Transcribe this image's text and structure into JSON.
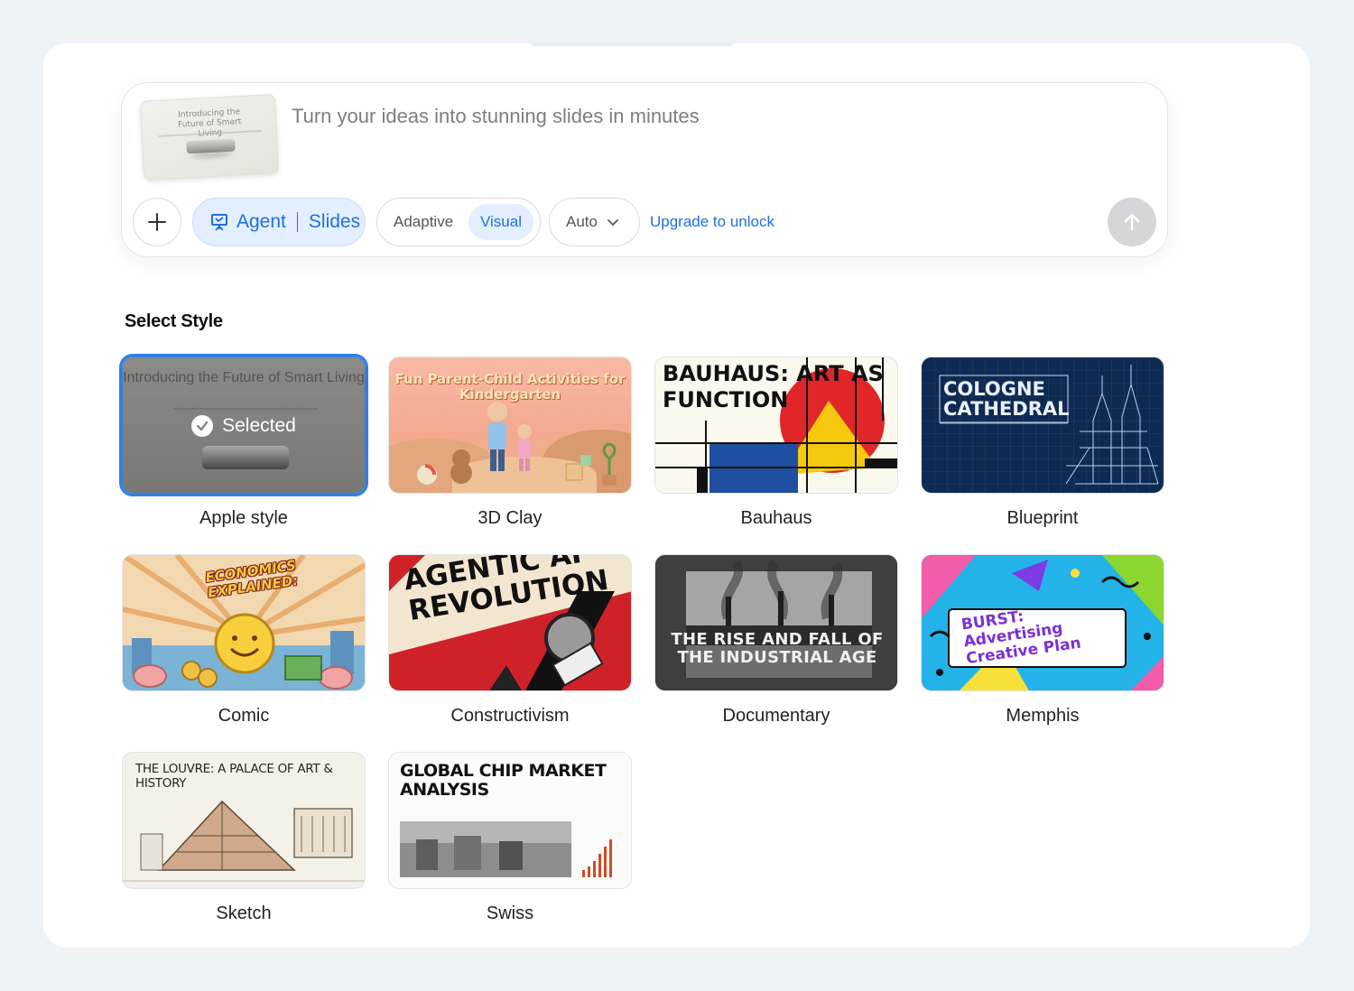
{
  "prompt": {
    "placeholder": "Turn your ideas into stunning slides in minutes",
    "thumbnail_title": "Introducing the Future of Smart Living",
    "agent_label": "Agent",
    "agent_mode": "Slides",
    "mode_options": [
      "Adaptive",
      "Visual"
    ],
    "selected_mode": "Visual",
    "auto_label": "Auto",
    "upgrade_label": "Upgrade to unlock"
  },
  "section": {
    "title": "Select Style"
  },
  "styles": [
    {
      "label": "Apple style",
      "selected": true,
      "selected_text": "Selected",
      "thumb_title": "Introducing the Future of Smart Living"
    },
    {
      "label": "3D Clay",
      "selected": false,
      "thumb_title": "Fun Parent-Child Activities for Kindergarten"
    },
    {
      "label": "Bauhaus",
      "selected": false,
      "thumb_title": "BAUHAUS: ART AS FUNCTION"
    },
    {
      "label": "Blueprint",
      "selected": false,
      "thumb_title": "COLOGNE CATHEDRAL"
    },
    {
      "label": "Comic",
      "selected": false,
      "thumb_title": "ECONOMICS EXPLAINED:"
    },
    {
      "label": "Constructivism",
      "selected": false,
      "thumb_title": "AGENTIC AI REVOLUTION"
    },
    {
      "label": "Documentary",
      "selected": false,
      "thumb_title": "THE RISE AND FALL OF THE INDUSTRIAL AGE"
    },
    {
      "label": "Memphis",
      "selected": false,
      "thumb_title": "BURST: Advertising Creative Plan"
    },
    {
      "label": "Sketch",
      "selected": false,
      "thumb_title": "THE LOUVRE: A PALACE OF ART & HISTORY"
    },
    {
      "label": "Swiss",
      "selected": false,
      "thumb_title": "GLOBAL CHIP MARKET ANALYSIS"
    }
  ]
}
